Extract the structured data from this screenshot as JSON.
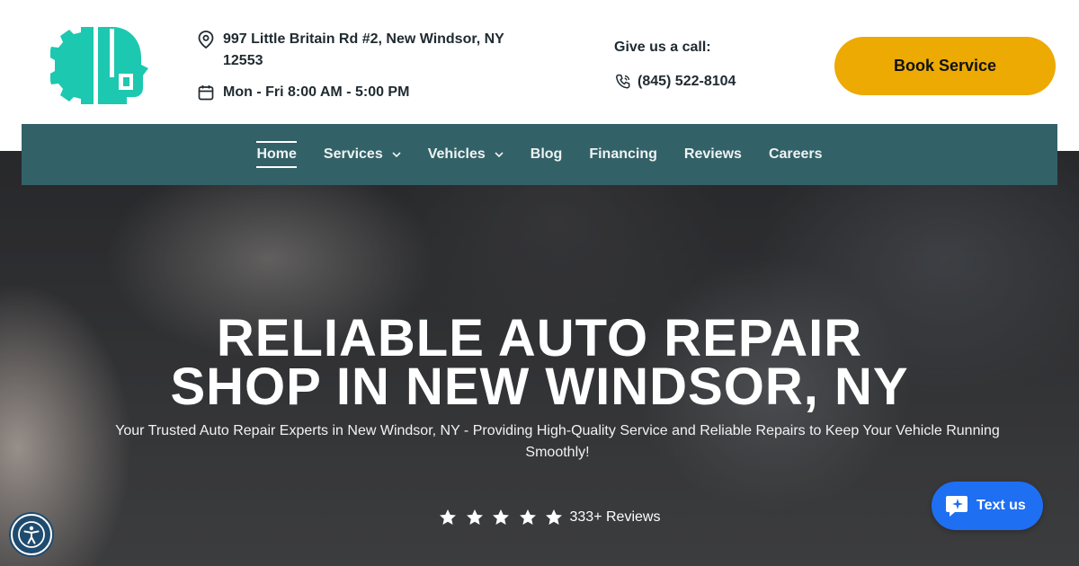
{
  "header": {
    "address": "997 Little Britain Rd #2, New Windsor, NY 12553",
    "hours": "Mon - Fri 8:00 AM - 5:00 PM",
    "call_label": "Give us a call:",
    "phone": "(845) 522-8104",
    "book_button": "Book Service"
  },
  "nav": {
    "items": [
      {
        "label": "Home",
        "active": true
      },
      {
        "label": "Services",
        "dropdown": true
      },
      {
        "label": "Vehicles",
        "dropdown": true
      },
      {
        "label": "Blog"
      },
      {
        "label": "Financing"
      },
      {
        "label": "Reviews"
      },
      {
        "label": "Careers"
      }
    ]
  },
  "hero": {
    "title_line1": "RELIABLE AUTO REPAIR",
    "title_line2": "SHOP IN NEW WINDSOR, NY",
    "subtitle": "Your Trusted Auto Repair Experts in New Windsor, NY - Providing High-Quality Service and Reliable Repairs to Keep Your Vehicle Running Smoothly!",
    "rating_stars": 5,
    "reviews_text": "333+ Reviews"
  },
  "widgets": {
    "text_us": "Text us"
  },
  "colors": {
    "brand_teal": "#1cc8b0",
    "nav_bg": "#336168",
    "book_button": "#ecaa03",
    "text_us_bg": "#1e6ff2",
    "accessibility_bg": "#1f4b6f"
  },
  "icons": {
    "logo": "head-gear-logo",
    "address": "map-pin-icon",
    "hours": "calendar-icon",
    "phone": "phone-icon",
    "nav_dropdown": "chevron-down-icon",
    "rating": "star-icon",
    "accessibility": "accessibility-icon",
    "text_us": "chat-bubble-icon"
  }
}
